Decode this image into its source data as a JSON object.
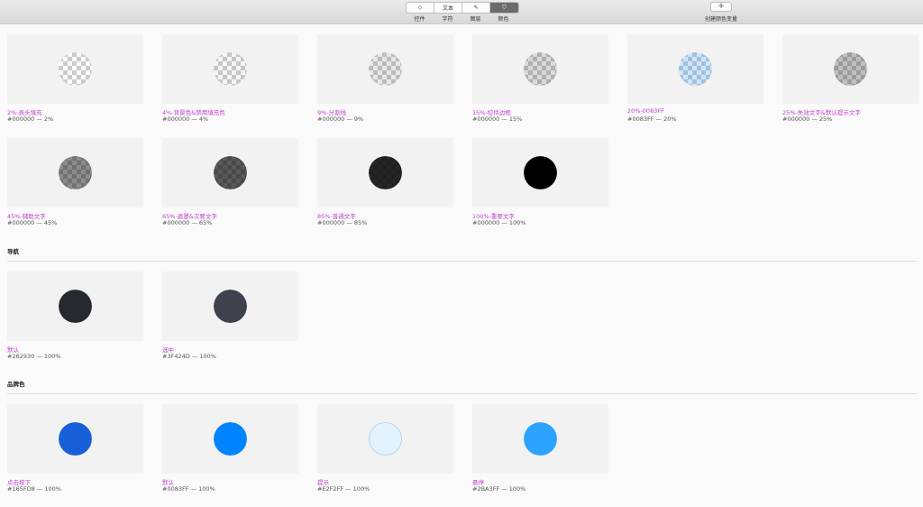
{
  "toolbar": {
    "tabs": [
      {
        "icon": "diamond-icon",
        "glyph": "◇",
        "label": "控件"
      },
      {
        "icon": "text-icon",
        "glyph": "文本",
        "label": "字符"
      },
      {
        "icon": "pen-icon",
        "glyph": "✎",
        "label": "图层"
      },
      {
        "icon": "paint-bucket-icon",
        "glyph": "⛉",
        "label": "颜色"
      }
    ],
    "add_glyph": "+",
    "add_label": "创建颜色变量"
  },
  "sections": {
    "nav_title": "导航",
    "brand_title": "品牌色"
  },
  "colors": [
    {
      "name": "2%-表头填充",
      "value": "#000000 — 2%",
      "hex": "#000000",
      "opacity": 0.02
    },
    {
      "name": "4%-背景色&禁用填充色",
      "value": "#000000 — 4%",
      "hex": "#000000",
      "opacity": 0.04
    },
    {
      "name": "9%-分割线",
      "value": "#000000 — 9%",
      "hex": "#000000",
      "opacity": 0.09
    },
    {
      "name": "15%-控件边框",
      "value": "#000000 — 15%",
      "hex": "#000000",
      "opacity": 0.15
    },
    {
      "name": "20%-0083FF",
      "value": "#0083FF — 20%",
      "hex": "#0083FF",
      "opacity": 0.2
    },
    {
      "name": "25%-失效文字&默认提示文字",
      "value": "#000000 — 25%",
      "hex": "#000000",
      "opacity": 0.25
    },
    {
      "name": "45%-辅助文字",
      "value": "#000000 — 45%",
      "hex": "#000000",
      "opacity": 0.45
    },
    {
      "name": "65%-遮罩&次要文字",
      "value": "#000000 — 65%",
      "hex": "#000000",
      "opacity": 0.65
    },
    {
      "name": "85%-普通文字",
      "value": "#000000 — 85%",
      "hex": "#000000",
      "opacity": 0.85
    },
    {
      "name": "100%-重要文字",
      "value": "#000000 — 100%",
      "hex": "#000000",
      "opacity": 1
    }
  ],
  "nav": [
    {
      "name": "默认",
      "value": "#262930 — 100%",
      "hex": "#262930",
      "opacity": 1
    },
    {
      "name": "选中",
      "value": "#3F424D — 100%",
      "hex": "#3F424D",
      "opacity": 1
    }
  ],
  "brand": [
    {
      "name": "点击按下",
      "value": "#165FD8 — 100%",
      "hex": "#165FD8",
      "opacity": 1
    },
    {
      "name": "默认",
      "value": "#0083FF — 100%",
      "hex": "#0083FF",
      "opacity": 1
    },
    {
      "name": "提示",
      "value": "#E2F2FF — 100%",
      "hex": "#E2F2FF",
      "opacity": 1
    },
    {
      "name": "悬停",
      "value": "#2BA3FF — 100%",
      "hex": "#2BA3FF",
      "opacity": 1
    }
  ]
}
